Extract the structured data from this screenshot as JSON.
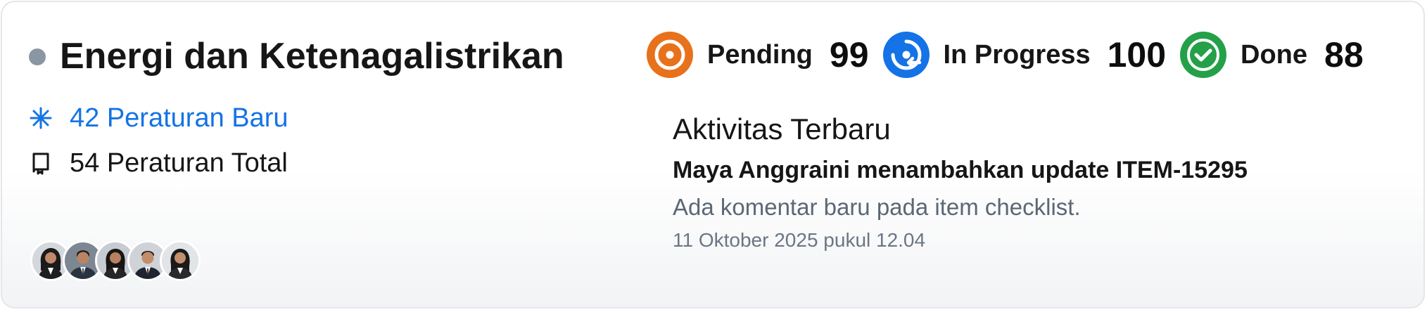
{
  "card": {
    "title": "Energi dan Ketenagalistrikan",
    "status_dot_color": "#8a96a3",
    "new_regulations": "42 Peraturan Baru",
    "total_regulations": "54 Peraturan Total",
    "new_icon": "asterisk-icon",
    "total_icon": "book-icon",
    "avatar_count": 5
  },
  "statuses": [
    {
      "label": "Pending",
      "count": "99",
      "icon": "pending-icon",
      "color": "#e8711c"
    },
    {
      "label": "In Progress",
      "count": "100",
      "icon": "in-progress-icon",
      "color": "#1473e6"
    },
    {
      "label": "Done",
      "count": "88",
      "icon": "check-circle-icon",
      "color": "#24a148"
    }
  ],
  "activity": {
    "heading": "Aktivitas Terbaru",
    "text": "Maya Anggraini menambahkan update ITEM-15295",
    "description": "Ada komentar baru pada item checklist.",
    "timestamp": "11 Oktober 2025 pukul 12.04"
  },
  "colors": {
    "accent": "#1473e6",
    "text_primary": "#161616",
    "text_secondary": "#5b6775"
  }
}
